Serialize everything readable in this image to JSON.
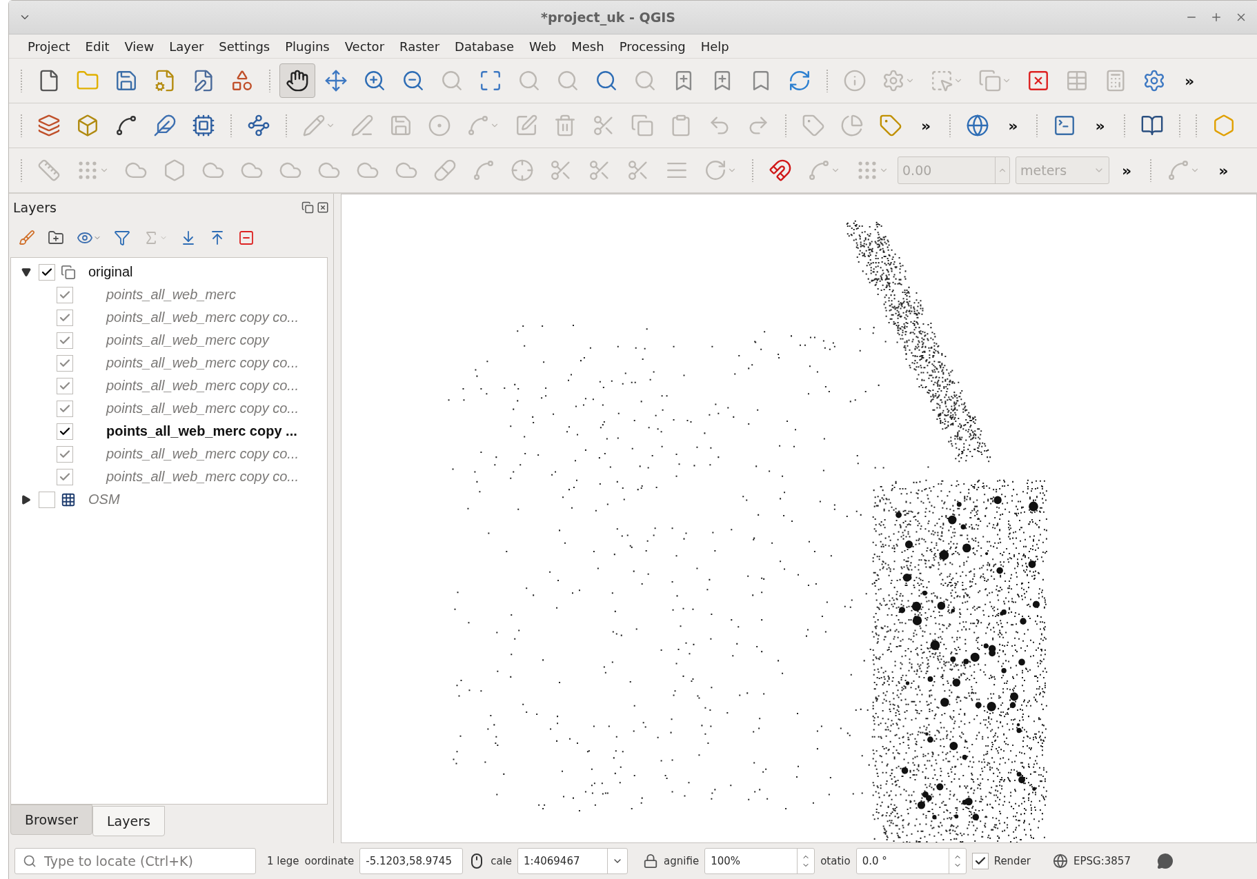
{
  "window": {
    "title": "*project_uk - QGIS"
  },
  "menu": [
    {
      "label": "Project"
    },
    {
      "label": "Edit"
    },
    {
      "label": "View"
    },
    {
      "label": "Layer"
    },
    {
      "label": "Settings"
    },
    {
      "label": "Plugins"
    },
    {
      "label": "Vector"
    },
    {
      "label": "Raster"
    },
    {
      "label": "Database"
    },
    {
      "label": "Web"
    },
    {
      "label": "Mesh"
    },
    {
      "label": "Processing"
    },
    {
      "label": "Help"
    }
  ],
  "toolbars": [
    {
      "items": [
        {
          "kind": "icon",
          "disabled": false,
          "selected": false
        },
        {
          "kind": "icon",
          "disabled": false,
          "selected": false
        },
        {
          "kind": "icon",
          "disabled": false,
          "selected": false
        },
        {
          "kind": "icon",
          "disabled": false,
          "selected": false
        },
        {
          "kind": "icon",
          "disabled": false,
          "selected": false
        },
        {
          "kind": "icon",
          "disabled": false,
          "selected": false
        },
        {
          "kind": "icon",
          "disabled": false,
          "selected": true
        },
        {
          "kind": "icon",
          "disabled": false,
          "selected": false
        },
        {
          "kind": "icon",
          "disabled": false,
          "selected": false
        },
        {
          "kind": "icon",
          "disabled": false,
          "selected": false
        },
        {
          "kind": "icon",
          "disabled": true,
          "selected": false
        },
        {
          "kind": "icon",
          "disabled": false,
          "selected": false
        },
        {
          "kind": "icon",
          "disabled": true,
          "selected": false
        },
        {
          "kind": "icon",
          "disabled": true,
          "selected": false
        },
        {
          "kind": "icon",
          "disabled": false,
          "selected": false
        },
        {
          "kind": "icon",
          "disabled": true,
          "selected": false
        },
        {
          "kind": "icon",
          "disabled": false,
          "selected": false
        },
        {
          "kind": "icon",
          "disabled": false,
          "selected": false
        },
        {
          "kind": "icon",
          "disabled": false,
          "selected": false
        },
        {
          "kind": "icon",
          "disabled": false,
          "selected": false
        },
        {
          "kind": "icon",
          "disabled": true,
          "selected": false
        },
        {
          "kind": "icon",
          "disabled": true,
          "selected": false
        },
        {
          "kind": "icon",
          "disabled": true,
          "selected": false
        },
        {
          "kind": "icon",
          "disabled": true,
          "selected": false
        },
        {
          "kind": "icon",
          "disabled": false,
          "selected": false
        },
        {
          "kind": "icon",
          "disabled": true,
          "selected": false
        },
        {
          "kind": "icon",
          "disabled": true,
          "selected": false
        },
        {
          "kind": "icon",
          "disabled": false,
          "selected": false
        },
        {
          "kind": "more",
          "label": "»"
        }
      ]
    },
    {
      "items": [
        {
          "kind": "icon",
          "disabled": false
        },
        {
          "kind": "icon",
          "disabled": false
        },
        {
          "kind": "icon",
          "disabled": false
        },
        {
          "kind": "icon",
          "disabled": false
        },
        {
          "kind": "icon",
          "disabled": false
        },
        {
          "kind": "icon",
          "disabled": false
        },
        {
          "kind": "icon",
          "disabled": true
        },
        {
          "kind": "icon",
          "disabled": true
        },
        {
          "kind": "icon",
          "disabled": true
        },
        {
          "kind": "icon",
          "disabled": true
        },
        {
          "kind": "icon",
          "disabled": true
        },
        {
          "kind": "icon",
          "disabled": true
        },
        {
          "kind": "icon",
          "disabled": true
        },
        {
          "kind": "icon",
          "disabled": true
        },
        {
          "kind": "icon",
          "disabled": true
        },
        {
          "kind": "icon",
          "disabled": true
        },
        {
          "kind": "icon",
          "disabled": true
        },
        {
          "kind": "icon",
          "disabled": true
        },
        {
          "kind": "icon",
          "disabled": true
        },
        {
          "kind": "icon",
          "disabled": true
        },
        {
          "kind": "icon",
          "disabled": false
        },
        {
          "kind": "more",
          "label": "»"
        },
        {
          "kind": "icon",
          "disabled": false
        },
        {
          "kind": "more",
          "label": "»"
        },
        {
          "kind": "icon",
          "disabled": false
        },
        {
          "kind": "more",
          "label": "»"
        },
        {
          "kind": "icon",
          "disabled": false
        },
        {
          "kind": "icon",
          "disabled": false
        }
      ]
    },
    {
      "items": [
        {
          "kind": "icon",
          "disabled": true
        },
        {
          "kind": "icon",
          "disabled": true
        },
        {
          "kind": "icon",
          "disabled": true
        },
        {
          "kind": "icon",
          "disabled": true
        },
        {
          "kind": "icon",
          "disabled": true
        },
        {
          "kind": "icon",
          "disabled": true
        },
        {
          "kind": "icon",
          "disabled": true
        },
        {
          "kind": "icon",
          "disabled": true
        },
        {
          "kind": "icon",
          "disabled": true
        },
        {
          "kind": "icon",
          "disabled": true
        },
        {
          "kind": "icon",
          "disabled": true
        },
        {
          "kind": "icon",
          "disabled": true
        },
        {
          "kind": "icon",
          "disabled": true
        },
        {
          "kind": "icon",
          "disabled": true
        },
        {
          "kind": "icon",
          "disabled": true
        },
        {
          "kind": "icon",
          "disabled": true
        },
        {
          "kind": "icon",
          "disabled": true
        },
        {
          "kind": "icon",
          "disabled": true
        },
        {
          "kind": "icon",
          "disabled": false
        },
        {
          "kind": "icon",
          "disabled": true
        },
        {
          "kind": "icon",
          "disabled": true
        },
        {
          "kind": "field",
          "value": "0.00",
          "disabled": true
        },
        {
          "kind": "combo",
          "value": "meters",
          "disabled": true
        },
        {
          "kind": "more",
          "label": "»"
        },
        {
          "kind": "icon",
          "disabled": true
        },
        {
          "kind": "more",
          "label": "»"
        }
      ]
    }
  ],
  "layers_panel": {
    "title": "Layers",
    "toolbar": [
      {
        "disabled": false
      },
      {
        "disabled": false
      },
      {
        "disabled": false
      },
      {
        "disabled": false
      },
      {
        "disabled": true
      },
      {
        "disabled": false
      },
      {
        "disabled": false
      },
      {
        "disabled": false
      }
    ],
    "tree": [
      {
        "label": "original",
        "kind": "group",
        "expanded": true,
        "checked": true,
        "greyed": false,
        "children": [
          {
            "label": "points_all_web_merc",
            "kind": "vector",
            "checked": true,
            "greyed": true
          },
          {
            "label": "points_all_web_merc copy co...",
            "kind": "vector",
            "checked": true,
            "greyed": true
          },
          {
            "label": "points_all_web_merc copy",
            "kind": "vector",
            "checked": true,
            "greyed": true
          },
          {
            "label": "points_all_web_merc copy co...",
            "kind": "vector",
            "checked": true,
            "greyed": true
          },
          {
            "label": "points_all_web_merc copy co...",
            "kind": "vector",
            "checked": true,
            "greyed": true
          },
          {
            "label": "points_all_web_merc copy co...",
            "kind": "vector",
            "checked": true,
            "greyed": true
          },
          {
            "label": "points_all_web_merc copy ...",
            "kind": "vector",
            "checked": true,
            "greyed": false
          },
          {
            "label": "points_all_web_merc copy co...",
            "kind": "vector",
            "checked": true,
            "greyed": true
          },
          {
            "label": "points_all_web_merc copy co...",
            "kind": "vector",
            "checked": true,
            "greyed": true
          }
        ]
      },
      {
        "label": "OSM",
        "kind": "raster",
        "expanded": false,
        "checked": false,
        "greyed": true
      }
    ],
    "tabs": [
      {
        "label": "Browser",
        "selected": false
      },
      {
        "label": "Layers",
        "selected": true
      }
    ]
  },
  "status_bar": {
    "search": {
      "placeholder": "Type to locate (Ctrl+K)"
    },
    "legend_text": "1 lege",
    "coordinate_label": "oordinate",
    "coordinate": "-5.1203,58.9745",
    "scale_label": "cale",
    "scale": "1:4069467",
    "magnifier_label": "agnifie",
    "magnifier": "100%",
    "rotation_label": "otatio",
    "rotation": "0.0 °",
    "render": {
      "label": "Render",
      "checked": true
    },
    "crs": "EPSG:3857"
  }
}
